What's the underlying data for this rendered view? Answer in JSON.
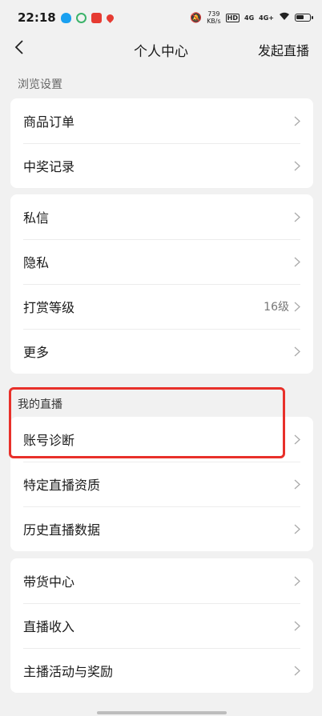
{
  "status_bar": {
    "time": "22:18",
    "net_speed_value": "739",
    "net_speed_unit": "KB/s",
    "hd_badge": "HD",
    "sig1": "4G",
    "sig2": "4G+"
  },
  "nav": {
    "title": "个人中心",
    "action": "发起直播"
  },
  "sections": {
    "browse_settings": "浏览设置",
    "my_live": "我的直播"
  },
  "group1": [
    {
      "label": "商品订单"
    },
    {
      "label": "中奖记录"
    }
  ],
  "group2": [
    {
      "label": "私信"
    },
    {
      "label": "隐私"
    },
    {
      "label": "打赏等级",
      "value": "16级"
    },
    {
      "label": "更多"
    }
  ],
  "group3": [
    {
      "label": "账号诊断"
    },
    {
      "label": "特定直播资质"
    },
    {
      "label": "历史直播数据"
    }
  ],
  "group4": [
    {
      "label": "带货中心"
    },
    {
      "label": "直播收入"
    },
    {
      "label": "主播活动与奖励"
    }
  ],
  "colors": {
    "highlight": "#e8302a",
    "background": "#f1f1f1"
  },
  "icons": {
    "back": "chevron-left-icon",
    "row": "chevron-right-icon"
  }
}
